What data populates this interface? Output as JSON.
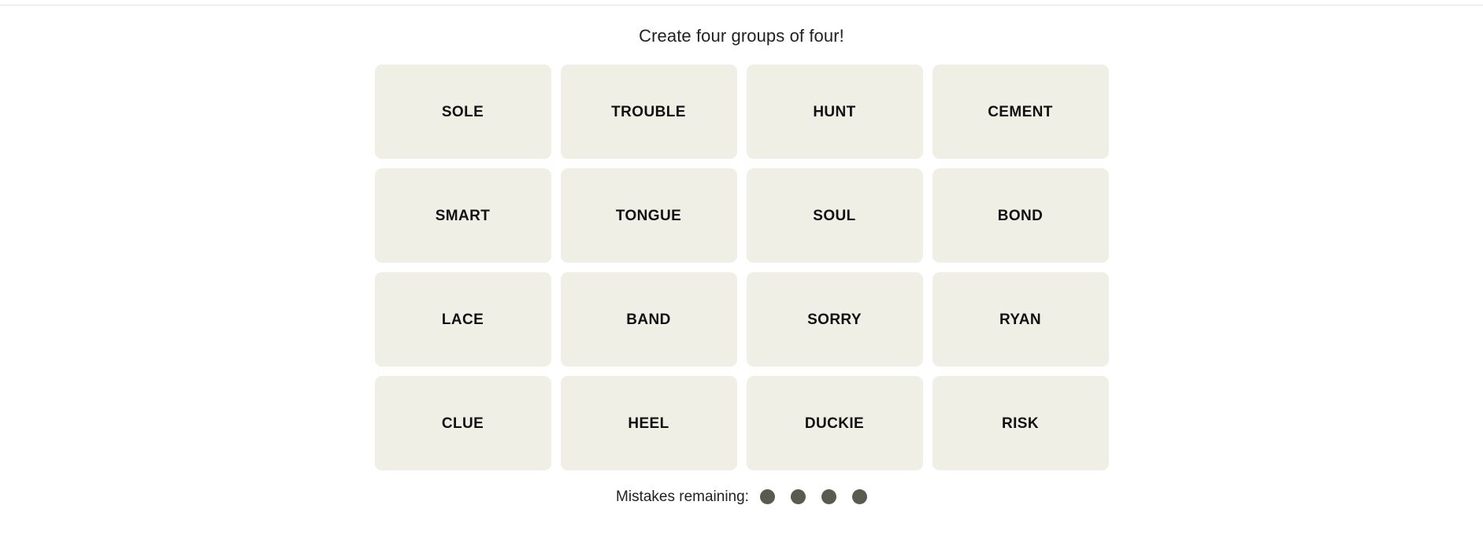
{
  "page": {
    "background_color": "#ffffff",
    "divider_color": "#e4e4e4"
  },
  "game": {
    "title": "Create four groups of four!",
    "tile_background_color": "#efefe6",
    "tile_text_color": "#111111",
    "grid": {
      "rows": 4,
      "columns": 4,
      "tiles": [
        {
          "label": "SOLE"
        },
        {
          "label": "TROUBLE"
        },
        {
          "label": "HUNT"
        },
        {
          "label": "CEMENT"
        },
        {
          "label": "SMART"
        },
        {
          "label": "TONGUE"
        },
        {
          "label": "SOUL"
        },
        {
          "label": "BOND"
        },
        {
          "label": "LACE"
        },
        {
          "label": "BAND"
        },
        {
          "label": "SORRY"
        },
        {
          "label": "RYAN"
        },
        {
          "label": "CLUE"
        },
        {
          "label": "HEEL"
        },
        {
          "label": "DUCKIE"
        },
        {
          "label": "RISK"
        }
      ]
    },
    "mistakes": {
      "label": "Mistakes remaining:",
      "remaining": 4,
      "dot_color": "#5a5a4e",
      "dots": [
        {
          "name": "mistake-dot-1"
        },
        {
          "name": "mistake-dot-2"
        },
        {
          "name": "mistake-dot-3"
        },
        {
          "name": "mistake-dot-4"
        }
      ]
    }
  }
}
